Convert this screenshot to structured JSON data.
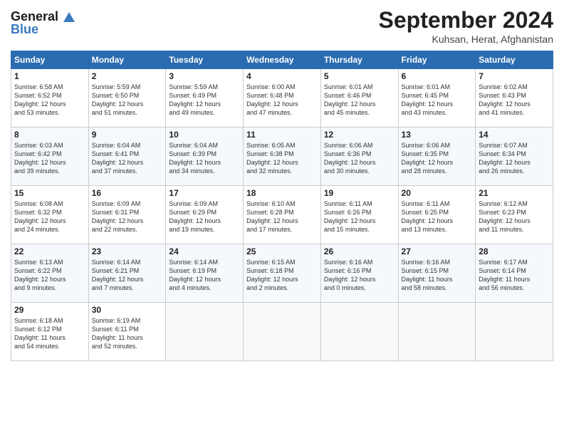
{
  "header": {
    "logo_line1": "General",
    "logo_line2": "Blue",
    "month": "September 2024",
    "location": "Kuhsan, Herat, Afghanistan"
  },
  "weekdays": [
    "Sunday",
    "Monday",
    "Tuesday",
    "Wednesday",
    "Thursday",
    "Friday",
    "Saturday"
  ],
  "weeks": [
    [
      {
        "day": "1",
        "sunrise": "6:58 AM",
        "sunset": "6:52 PM",
        "daylight": "12 hours and 53 minutes."
      },
      {
        "day": "2",
        "sunrise": "5:59 AM",
        "sunset": "6:50 PM",
        "daylight": "12 hours and 51 minutes."
      },
      {
        "day": "3",
        "sunrise": "5:59 AM",
        "sunset": "6:49 PM",
        "daylight": "12 hours and 49 minutes."
      },
      {
        "day": "4",
        "sunrise": "6:00 AM",
        "sunset": "6:48 PM",
        "daylight": "12 hours and 47 minutes."
      },
      {
        "day": "5",
        "sunrise": "6:01 AM",
        "sunset": "6:46 PM",
        "daylight": "12 hours and 45 minutes."
      },
      {
        "day": "6",
        "sunrise": "6:01 AM",
        "sunset": "6:45 PM",
        "daylight": "12 hours and 43 minutes."
      },
      {
        "day": "7",
        "sunrise": "6:02 AM",
        "sunset": "6:43 PM",
        "daylight": "12 hours and 41 minutes."
      }
    ],
    [
      {
        "day": "8",
        "sunrise": "6:03 AM",
        "sunset": "6:42 PM",
        "daylight": "12 hours and 39 minutes."
      },
      {
        "day": "9",
        "sunrise": "6:04 AM",
        "sunset": "6:41 PM",
        "daylight": "12 hours and 37 minutes."
      },
      {
        "day": "10",
        "sunrise": "6:04 AM",
        "sunset": "6:39 PM",
        "daylight": "12 hours and 34 minutes."
      },
      {
        "day": "11",
        "sunrise": "6:05 AM",
        "sunset": "6:38 PM",
        "daylight": "12 hours and 32 minutes."
      },
      {
        "day": "12",
        "sunrise": "6:06 AM",
        "sunset": "6:36 PM",
        "daylight": "12 hours and 30 minutes."
      },
      {
        "day": "13",
        "sunrise": "6:06 AM",
        "sunset": "6:35 PM",
        "daylight": "12 hours and 28 minutes."
      },
      {
        "day": "14",
        "sunrise": "6:07 AM",
        "sunset": "6:34 PM",
        "daylight": "12 hours and 26 minutes."
      }
    ],
    [
      {
        "day": "15",
        "sunrise": "6:08 AM",
        "sunset": "6:32 PM",
        "daylight": "12 hours and 24 minutes."
      },
      {
        "day": "16",
        "sunrise": "6:09 AM",
        "sunset": "6:31 PM",
        "daylight": "12 hours and 22 minutes."
      },
      {
        "day": "17",
        "sunrise": "6:09 AM",
        "sunset": "6:29 PM",
        "daylight": "12 hours and 19 minutes."
      },
      {
        "day": "18",
        "sunrise": "6:10 AM",
        "sunset": "6:28 PM",
        "daylight": "12 hours and 17 minutes."
      },
      {
        "day": "19",
        "sunrise": "6:11 AM",
        "sunset": "6:26 PM",
        "daylight": "12 hours and 15 minutes."
      },
      {
        "day": "20",
        "sunrise": "6:11 AM",
        "sunset": "6:25 PM",
        "daylight": "12 hours and 13 minutes."
      },
      {
        "day": "21",
        "sunrise": "6:12 AM",
        "sunset": "6:23 PM",
        "daylight": "12 hours and 11 minutes."
      }
    ],
    [
      {
        "day": "22",
        "sunrise": "6:13 AM",
        "sunset": "6:22 PM",
        "daylight": "12 hours and 9 minutes."
      },
      {
        "day": "23",
        "sunrise": "6:14 AM",
        "sunset": "6:21 PM",
        "daylight": "12 hours and 7 minutes."
      },
      {
        "day": "24",
        "sunrise": "6:14 AM",
        "sunset": "6:19 PM",
        "daylight": "12 hours and 4 minutes."
      },
      {
        "day": "25",
        "sunrise": "6:15 AM",
        "sunset": "6:18 PM",
        "daylight": "12 hours and 2 minutes."
      },
      {
        "day": "26",
        "sunrise": "6:16 AM",
        "sunset": "6:16 PM",
        "daylight": "12 hours and 0 minutes."
      },
      {
        "day": "27",
        "sunrise": "6:16 AM",
        "sunset": "6:15 PM",
        "daylight": "11 hours and 58 minutes."
      },
      {
        "day": "28",
        "sunrise": "6:17 AM",
        "sunset": "6:14 PM",
        "daylight": "11 hours and 56 minutes."
      }
    ],
    [
      {
        "day": "29",
        "sunrise": "6:18 AM",
        "sunset": "6:12 PM",
        "daylight": "11 hours and 54 minutes."
      },
      {
        "day": "30",
        "sunrise": "6:19 AM",
        "sunset": "6:11 PM",
        "daylight": "11 hours and 52 minutes."
      },
      null,
      null,
      null,
      null,
      null
    ]
  ]
}
